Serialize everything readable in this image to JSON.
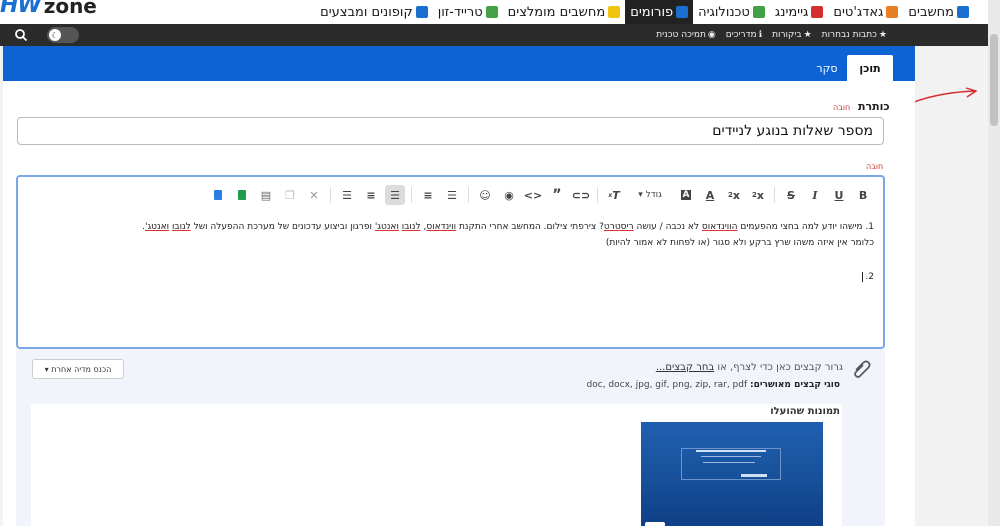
{
  "topnav": {
    "logo_hw": "HW",
    "logo_zone": "zone",
    "items": [
      {
        "label": "מחשבים",
        "icon": "laptop-icon",
        "color": "#1a6fd1"
      },
      {
        "label": "גאדג'טים",
        "icon": "phone-icon",
        "color": "#e67e22"
      },
      {
        "label": "גיימינג",
        "icon": "gamepad-icon",
        "color": "#d32f2f"
      },
      {
        "label": "טכנולוגיה",
        "icon": "flask-icon",
        "color": "#43a047"
      },
      {
        "label": "פורומים",
        "icon": "people-icon",
        "color": "#1a6fd1",
        "active": true
      },
      {
        "label": "מחשבים מומלצים",
        "icon": "list-icon",
        "color": "#f1c40f"
      },
      {
        "label": "טרייד-זון",
        "icon": "cart-icon",
        "color": "#43a047"
      },
      {
        "label": "קופונים ומבצעים",
        "icon": "truck-icon",
        "color": "#1a6fd1"
      }
    ]
  },
  "subnav": {
    "items": [
      {
        "label": "כתבות נבחרות",
        "glyph": "★"
      },
      {
        "label": "ביקורות",
        "glyph": "★"
      },
      {
        "label": "מדריכים",
        "glyph": "ℹ"
      },
      {
        "label": "תמיכה טכנית",
        "glyph": "◉"
      }
    ]
  },
  "tabs": {
    "content": "תוכן",
    "poll": "סקר"
  },
  "form": {
    "title_label": "כותרת",
    "required": "חובה",
    "title_value": "מספר שאלות בנוגע לניידים"
  },
  "toolbar": {
    "size_label": "גודל"
  },
  "editor": {
    "line1_prefix": "1. מישהו יודע למה בחצי מהפעמים ",
    "line1_u1": "הווינדאוס",
    "line1_mid1": " לא נכבה / עושה ",
    "line1_u2": "ריסטרט",
    "line1_mid2": "? צירפתי צילום. המחשב אחרי התקנת ",
    "line1_u3": "ווינדאוס",
    "line1_mid3": ", ",
    "line1_u4": "לנובו",
    "line1_mid4": " ",
    "line1_u5": "ואנטג'",
    "line1_mid5": " ופרגון וביצוע עדכונים של מערכת ההפעלה ושל ",
    "line1_u6": "לנובו",
    "line1_mid6": " ",
    "line1_u7": "ואנטג'",
    "line1_end": ".",
    "line1b": "כלומר אין איזה משהו שרץ ברקע ולא סגור (או לפחות לא אמור להיות)",
    "line2": "2."
  },
  "attachments": {
    "drop_prefix": "גרור קבצים כאן כדי לצרף, או ",
    "drop_link": "בחר קבצים...",
    "allowed_label": "סוגי קבצים מאושרים:",
    "allowed_types": "doc, docx, jpg, gif, png, zip, rar, pdf",
    "insert_media": "הכנס מדיה אחרת",
    "uploaded_title": "תמונות שהועלו"
  }
}
